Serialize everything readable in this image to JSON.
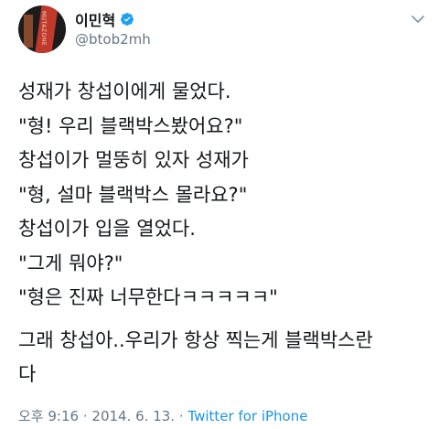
{
  "user": {
    "display_name": "이민혁",
    "handle": "@btob2mh",
    "avatar_text": "MUTAZONE"
  },
  "tweet": {
    "lines": [
      "성재가 창섭이에게 물었다.",
      "\"형! 우리 블랙박스봤어요?\"",
      "창섭이가 멀뚱히 있자 성재가",
      "\"형, 설마 블랙박스 몰라요?\"",
      "창섭이가 입을 열었다.",
      "\"그게 뭐야?\"",
      "\"형은 진짜 너무한다ㅋㅋㅋㅋㅋ\"",
      "그래 창섭아..우리가 항상 찍는게 블랙박스란",
      "다"
    ]
  },
  "meta": {
    "time": "오후 9:16",
    "separator": "·",
    "date": "2014. 6. 13.",
    "source": "Twitter for iPhone"
  },
  "colors": {
    "text": "#14171a",
    "muted": "#657786",
    "accent": "#1b95e0"
  },
  "icons": {
    "verified": "verified-badge-icon",
    "menu": "chevron-down-icon"
  }
}
